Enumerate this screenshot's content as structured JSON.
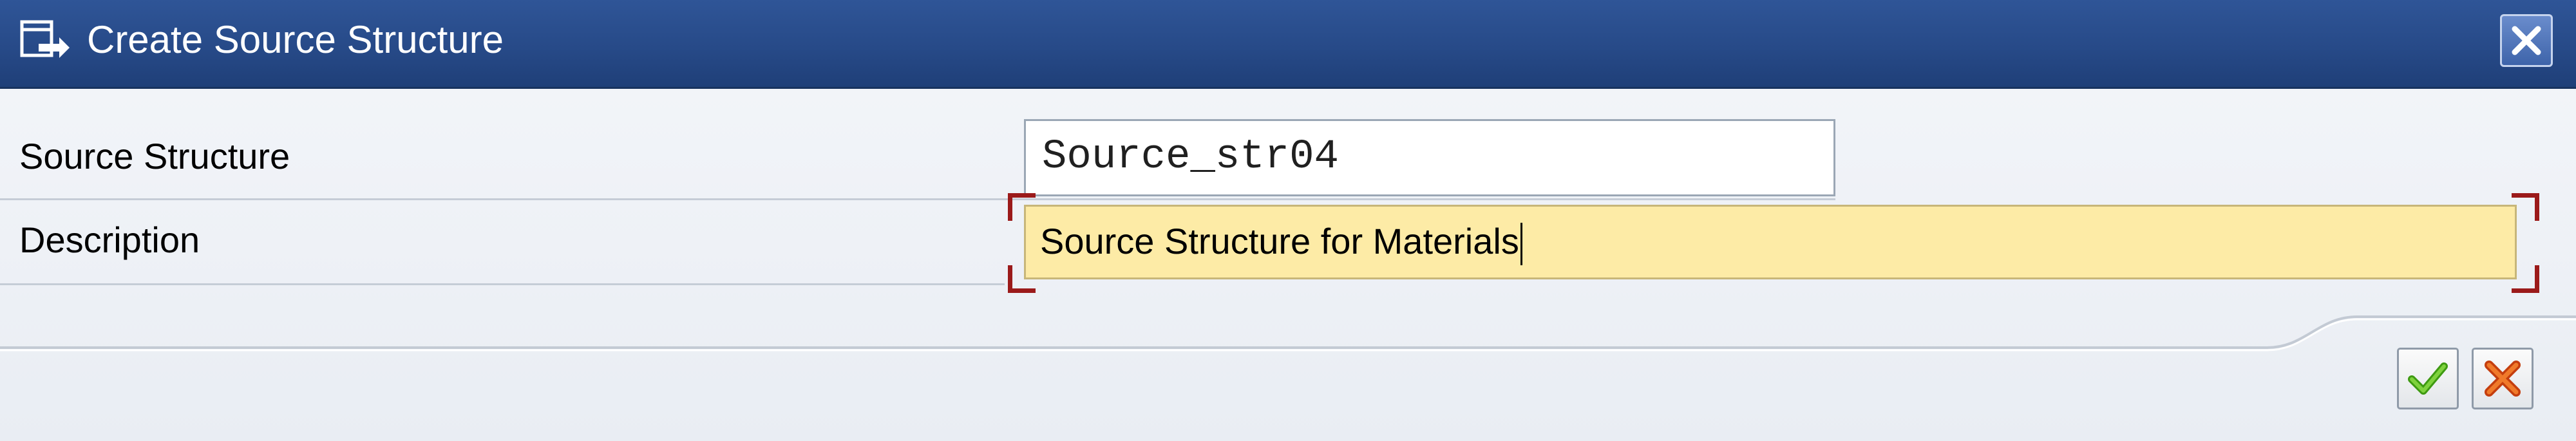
{
  "window": {
    "title": "Create Source Structure",
    "icon": "create-dialog-icon",
    "close_icon": "close-icon"
  },
  "form": {
    "source_structure": {
      "label": "Source Structure",
      "value": "Source_str04"
    },
    "description": {
      "label": "Description",
      "value": "Source Structure for Materials"
    }
  },
  "footer": {
    "ok_icon": "checkmark-icon",
    "cancel_icon": "cancel-icon"
  },
  "colors": {
    "titlebar": "#2a4f8f",
    "focused_field": "#fdeba6",
    "focus_corner": "#9b1a1a",
    "ok_green": "#4caf1a",
    "cancel_orange": "#e05a1a"
  }
}
